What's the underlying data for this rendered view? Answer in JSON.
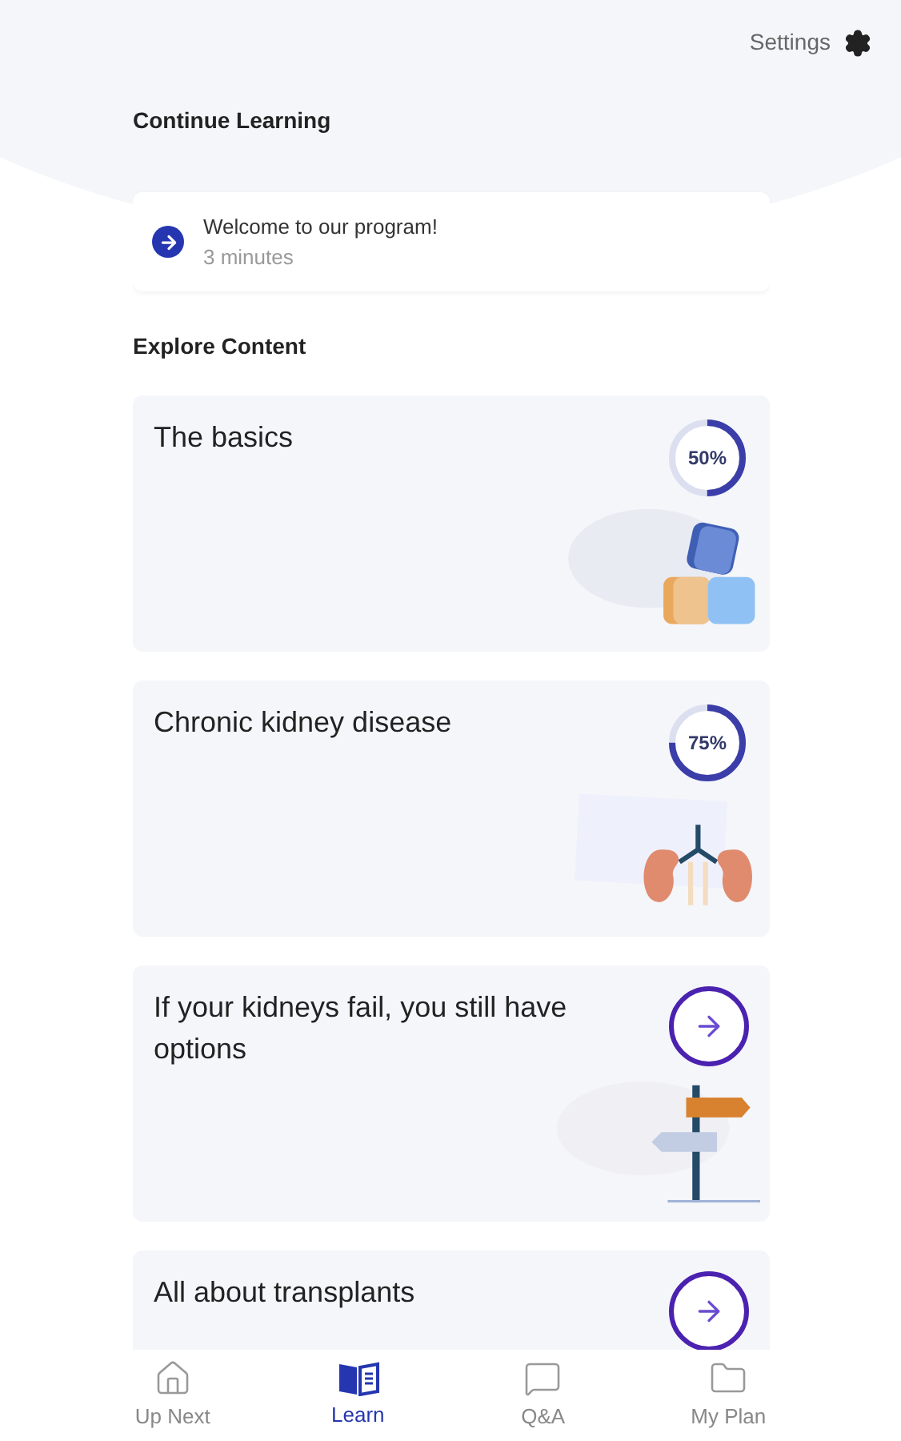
{
  "header": {
    "settings_label": "Settings"
  },
  "continue_learning": {
    "title": "Continue Learning",
    "item": {
      "title": "Welcome to our program!",
      "duration": "3 minutes"
    }
  },
  "explore": {
    "title": "Explore Content",
    "cards": [
      {
        "title": "The basics",
        "kind": "progress",
        "progress_label": "50%"
      },
      {
        "title": "Chronic kidney disease",
        "kind": "progress",
        "progress_label": "75%"
      },
      {
        "title": "If your kidneys fail, you still have options",
        "kind": "start"
      },
      {
        "title": "All about transplants",
        "kind": "start"
      }
    ]
  },
  "bottom_nav": [
    {
      "label": "Up Next",
      "selected": false
    },
    {
      "label": "Learn",
      "selected": true
    },
    {
      "label": "Q&A",
      "selected": false
    },
    {
      "label": "My Plan",
      "selected": false
    }
  ]
}
